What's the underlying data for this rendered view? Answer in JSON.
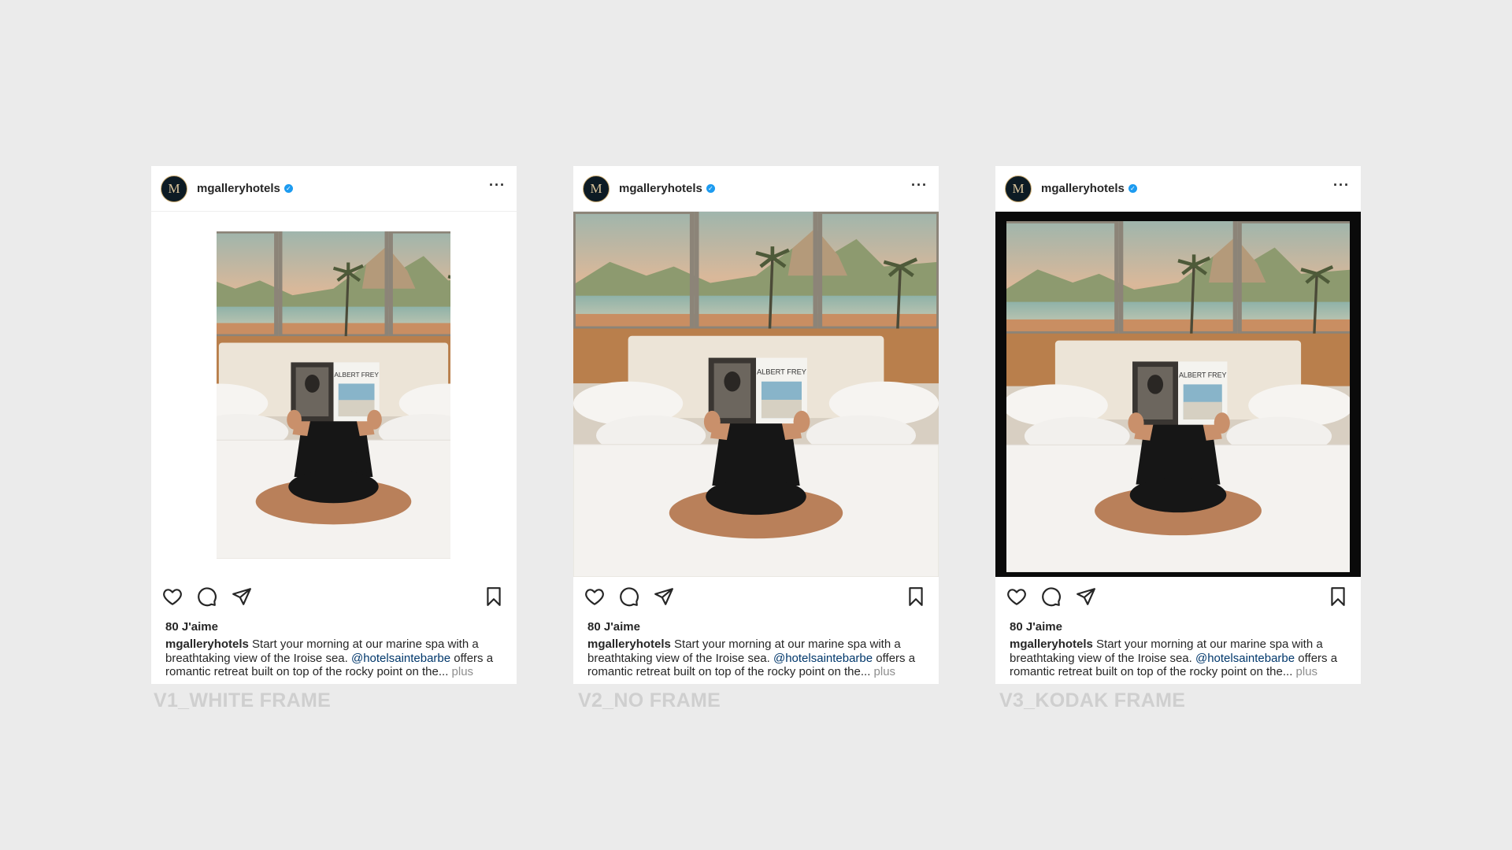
{
  "posts": [
    {
      "username": "mgalleryhotels",
      "avatar_letter": "M",
      "likes": "80 J'aime",
      "caption_user": "mgalleryhotels",
      "caption_text_1": " Start your morning at our marine spa with a breathtaking view of the Iroise sea. ",
      "caption_mention": "@hotelsaintebarbe",
      "caption_text_2": " offers a romantic retreat built on top of the rocky point on the... ",
      "caption_more": "plus",
      "version_label": "V1_WHITE FRAME",
      "book_title": "ALBERT FREY"
    },
    {
      "username": "mgalleryhotels",
      "avatar_letter": "M",
      "likes": "80 J'aime",
      "caption_user": "mgalleryhotels",
      "caption_text_1": " Start your morning at our marine spa with a breathtaking view of the Iroise sea. ",
      "caption_mention": "@hotelsaintebarbe",
      "caption_text_2": " offers a romantic retreat built on top of the rocky point on the... ",
      "caption_more": "plus",
      "version_label": "V2_NO FRAME",
      "book_title": "ALBERT FREY"
    },
    {
      "username": "mgalleryhotels",
      "avatar_letter": "M",
      "likes": "80 J'aime",
      "caption_user": "mgalleryhotels",
      "caption_text_1": " Start your morning at our marine spa with a breathtaking view of the Iroise sea. ",
      "caption_mention": "@hotelsaintebarbe",
      "caption_text_2": " offers a romantic retreat built on top of the rocky point on the... ",
      "caption_more": "plus",
      "version_label": "V3_KODAK FRAME",
      "book_title": "ALBERT FREY"
    }
  ],
  "icons": [
    "verified-icon",
    "more-options-icon",
    "heart-icon",
    "comment-icon",
    "share-icon",
    "bookmark-icon"
  ],
  "colors": {
    "background": "#ebebeb",
    "verified": "#1d9bf0",
    "mention": "#00376b",
    "label": "#cfcfcf"
  }
}
